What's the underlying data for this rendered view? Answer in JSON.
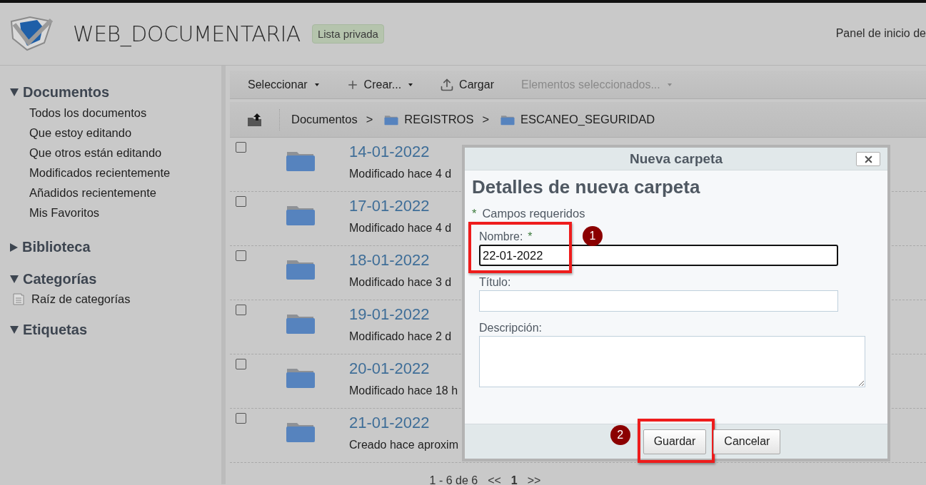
{
  "header": {
    "title": "WEB_DOCUMENTARIA",
    "badge": "Lista privada",
    "link": "Panel de inicio de"
  },
  "sidebar": {
    "sections": [
      {
        "title": "Documentos",
        "expanded": true,
        "items": [
          {
            "label": "Todos los documentos",
            "kind": "link"
          },
          {
            "label": "Que estoy editando",
            "kind": "link"
          },
          {
            "label": "Que otros están editando",
            "kind": "link"
          },
          {
            "label": "Modificados recientemente",
            "kind": "link"
          },
          {
            "label": "Añadidos recientemente",
            "kind": "link"
          },
          {
            "label": "Mis Favoritos",
            "kind": "link"
          }
        ]
      },
      {
        "title": "Biblioteca",
        "expanded": false
      },
      {
        "title": "Categorías",
        "expanded": true,
        "items": [
          {
            "label": "Raíz de categorías",
            "kind": "category"
          }
        ]
      },
      {
        "title": "Etiquetas",
        "expanded": true
      }
    ]
  },
  "toolbar": {
    "buttons": [
      {
        "label": "Seleccionar",
        "kind": "menu",
        "disabled": false
      },
      {
        "label": "Crear...",
        "kind": "create",
        "disabled": false
      },
      {
        "label": "Cargar",
        "kind": "upload",
        "disabled": false
      },
      {
        "label": "Elementos seleccionados...",
        "kind": "menu",
        "disabled": true
      }
    ]
  },
  "breadcrumb": {
    "items": [
      {
        "label": "Documentos",
        "kind": "root"
      },
      {
        "label": ">",
        "kind": "separator"
      },
      {
        "label": "REGISTROS",
        "kind": "folder"
      },
      {
        "label": ">",
        "kind": "separator"
      },
      {
        "label": "ESCANEO_SEGURIDAD",
        "kind": "folder"
      }
    ]
  },
  "rows": [
    {
      "title": "14-01-2022",
      "meta": "Modificado hace 4 d",
      "checked": false
    },
    {
      "title": "17-01-2022",
      "meta": "Modificado hace 4 d",
      "checked": false
    },
    {
      "title": "18-01-2022",
      "meta": "Modificado hace 3 d",
      "checked": false
    },
    {
      "title": "19-01-2022",
      "meta": "Modificado hace 2 d",
      "checked": false
    },
    {
      "title": "20-01-2022",
      "meta": "Modificado hace 18 h",
      "checked": false
    },
    {
      "title": "21-01-2022",
      "meta": "Creado hace aproxim",
      "checked": false
    }
  ],
  "pagination": {
    "range": "1 - 6 de 6",
    "prev": "<<",
    "page": "1",
    "next": ">>"
  },
  "dialog": {
    "title": "Nueva carpeta",
    "heading": "Detalles de nueva carpeta",
    "note": {
      "mark": "*",
      "text": "Campos requeridos"
    },
    "fields": [
      {
        "label": "Nombre:",
        "required_mark": "*",
        "kind": "input",
        "value": "22-01-2022",
        "focused": true,
        "annotation": "1"
      },
      {
        "label": "Título:",
        "kind": "input",
        "focused": false
      },
      {
        "label": "Descripción:",
        "kind": "textarea",
        "focused": false
      }
    ],
    "buttons": [
      {
        "label": "Guardar",
        "annotation": "2"
      },
      {
        "label": "Cancelar"
      }
    ]
  }
}
